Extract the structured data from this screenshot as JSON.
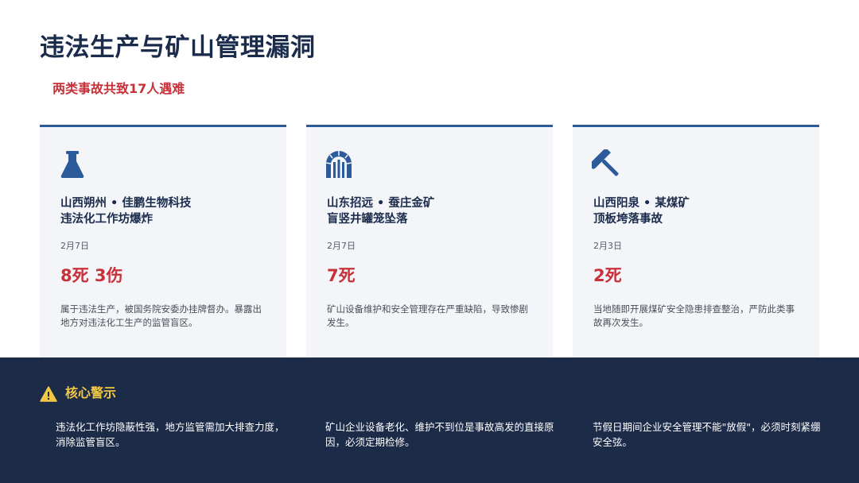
{
  "header": {
    "title": "违法生产与矿山管理漏洞",
    "subtitle": "两类事故共致17人遇难"
  },
  "cards": [
    {
      "icon": "flask-icon",
      "title_line1": "山西朔州 • 佳鹏生物科技",
      "title_line2": "违法化工作坊爆炸",
      "date": "2月7日",
      "casualties": "8死 3伤",
      "description": "属于违法生产，被国务院安委办挂牌督办。暴露出地方对违法化工生产的监管盲区。"
    },
    {
      "icon": "mine-arch-icon",
      "title_line1": "山东招远 • 蚕庄金矿",
      "title_line2": "盲竖井罐笼坠落",
      "date": "2月7日",
      "casualties": "7死",
      "description": "矿山设备维护和安全管理存在严重缺陷，导致惨剧发生。"
    },
    {
      "icon": "hammer-icon",
      "title_line1": "山西阳泉 • 某煤矿",
      "title_line2": "顶板垮落事故",
      "date": "2月3日",
      "casualties": "2死",
      "description": "当地随即开展煤矿安全隐患排查整治，严防此类事故再次发生。"
    }
  ],
  "warning": {
    "icon": "warning-triangle-icon",
    "title": "核心警示",
    "points": [
      "违法化工作坊隐蔽性强，地方监管需加大排查力度，消除监管盲区。",
      "矿山企业设备老化、维护不到位是事故高发的直接原因，必须定期检修。",
      "节假日期间企业安全管理不能\"放假\"，必须时刻紧绷安全弦。"
    ]
  },
  "colors": {
    "navy": "#1a2b4c",
    "accent_blue": "#2b5b9a",
    "alert_red": "#c8303a",
    "warning_yellow": "#f2c744",
    "panel_dark": "#1c2b48"
  }
}
